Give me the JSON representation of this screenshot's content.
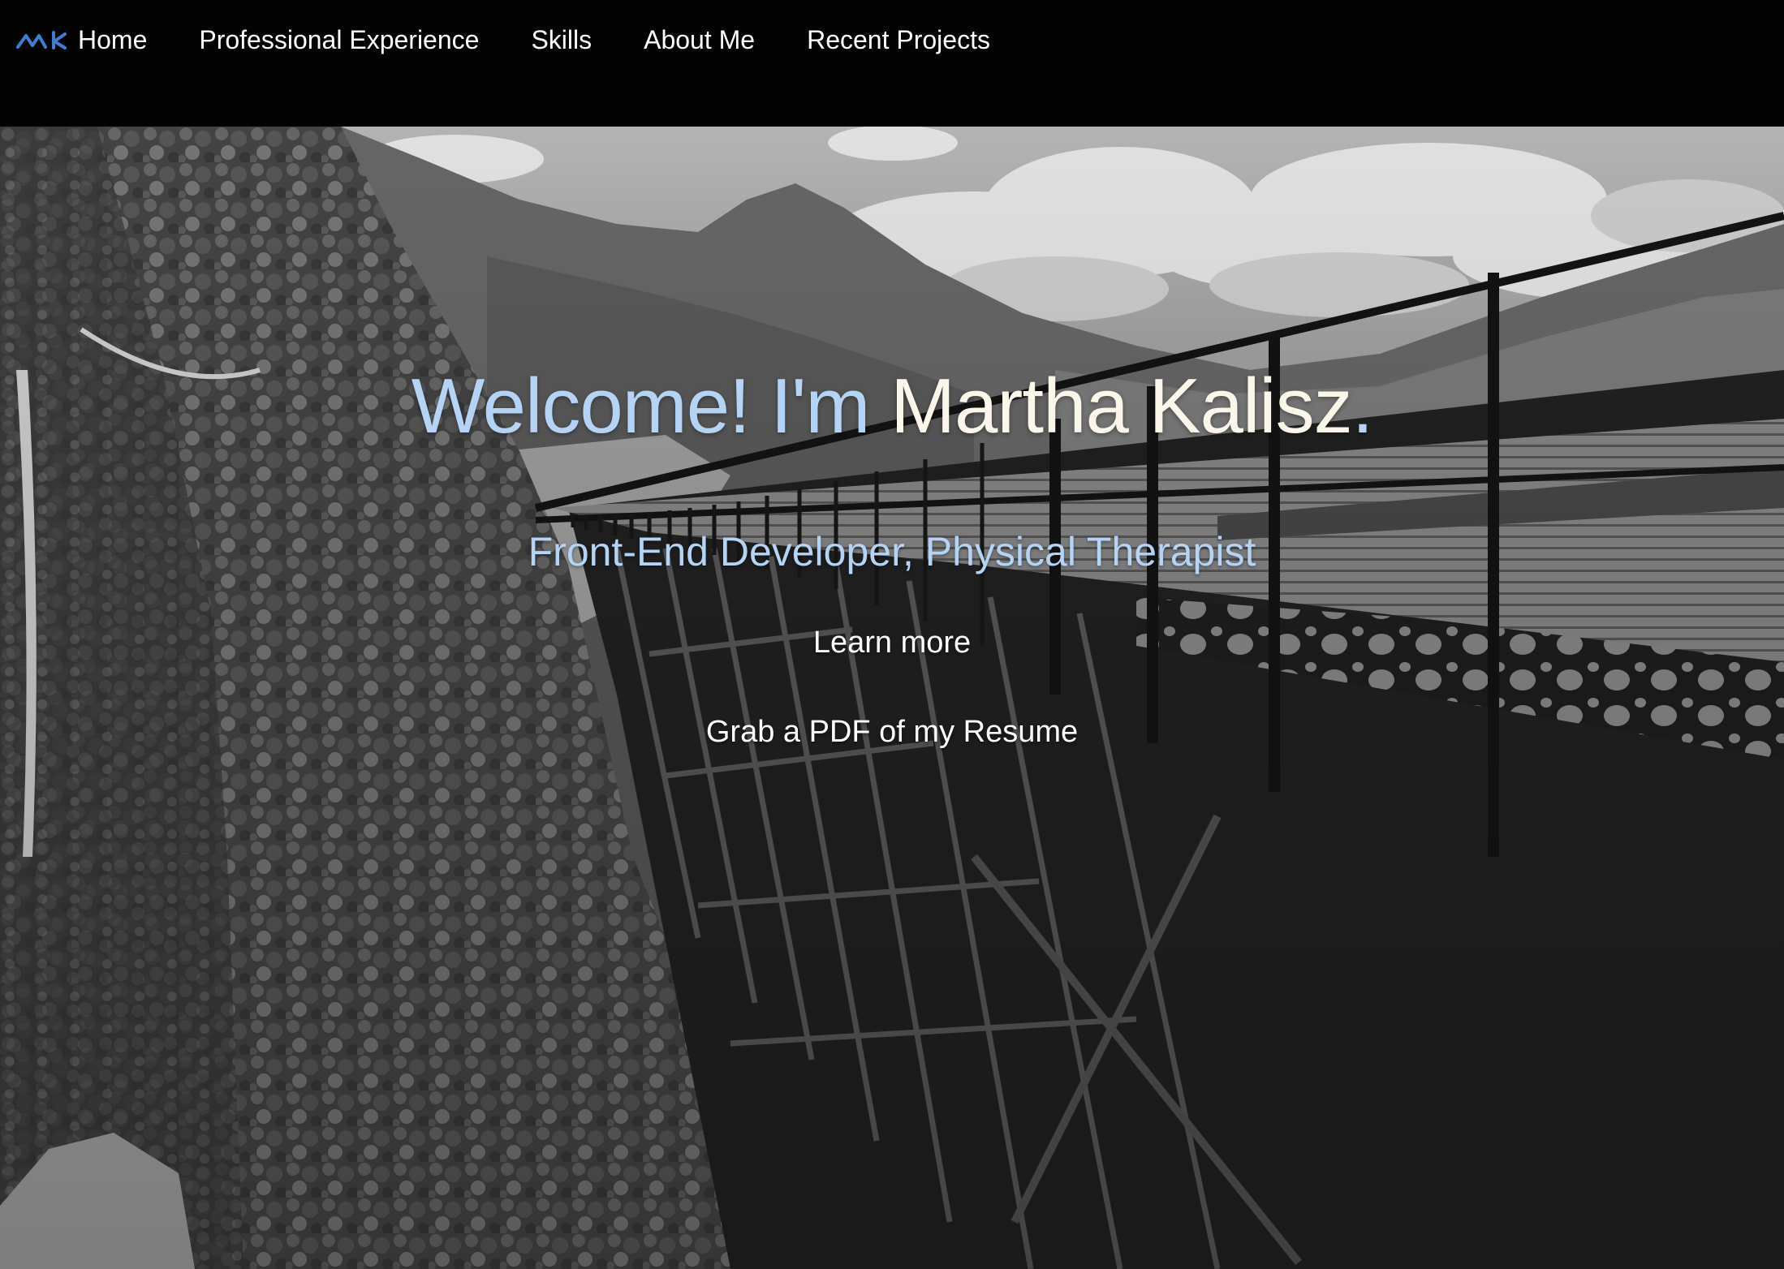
{
  "nav": {
    "logo": "logo-mk",
    "items": [
      {
        "label": "Home"
      },
      {
        "label": "Professional Experience"
      },
      {
        "label": "Skills"
      },
      {
        "label": "About Me"
      },
      {
        "label": "Recent Projects"
      }
    ]
  },
  "hero": {
    "intro": "Welcome! I'm ",
    "name": "Martha Kalisz",
    "dot": ".",
    "subtitle": "Front-End Developer, Physical Therapist",
    "learn_more": "Learn more",
    "resume": "Grab a PDF of my Resume"
  },
  "colors": {
    "accent_blue": "#b4d3f5",
    "name_cream": "#fbf6ea",
    "logo_blue": "#3c7fd2",
    "navbar_bg": "#030303"
  }
}
